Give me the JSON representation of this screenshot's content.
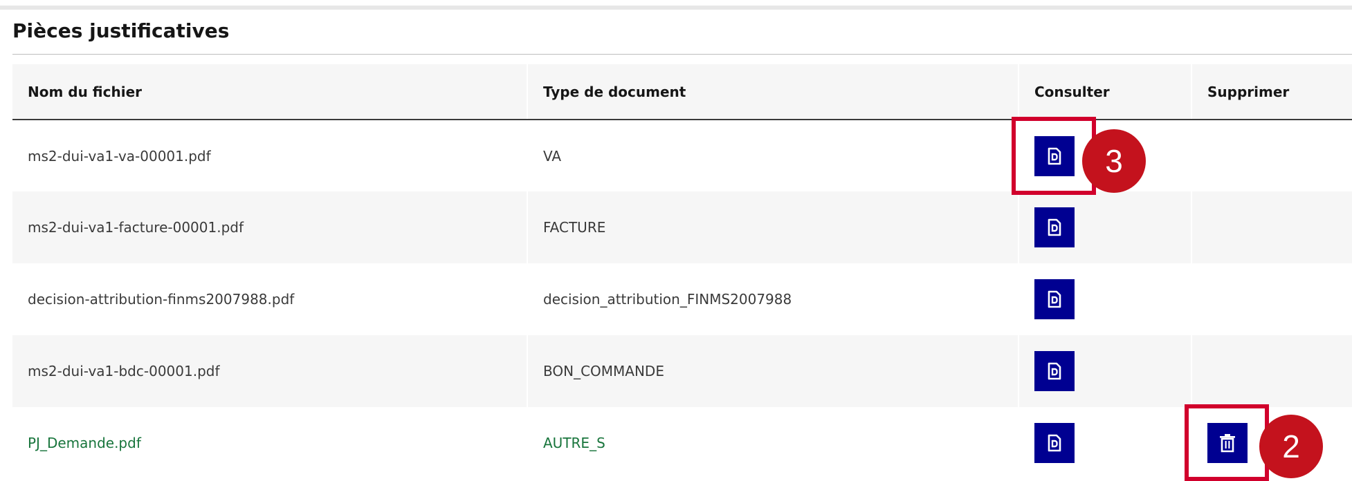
{
  "section": {
    "title": "Pièces justificatives"
  },
  "table": {
    "headers": {
      "file_name": "Nom du fichier",
      "doc_type": "Type de document",
      "view": "Consulter",
      "delete": "Supprimer"
    },
    "rows": [
      {
        "file_name": "ms2-dui-va1-va-00001.pdf",
        "doc_type": "VA",
        "can_delete": false
      },
      {
        "file_name": "ms2-dui-va1-facture-00001.pdf",
        "doc_type": "FACTURE",
        "can_delete": false
      },
      {
        "file_name": "decision-attribution-finms2007988.pdf",
        "doc_type": "decision_attribution_FINMS2007988",
        "can_delete": false
      },
      {
        "file_name": "ms2-dui-va1-bdc-00001.pdf",
        "doc_type": "BON_COMMANDE",
        "can_delete": false
      },
      {
        "file_name": "PJ_Demande.pdf",
        "doc_type": "AUTRE_S",
        "can_delete": true
      }
    ]
  },
  "icons": {
    "view": "document-icon",
    "delete": "trash-icon"
  },
  "callouts": {
    "view_marker": "3",
    "delete_marker": "2"
  },
  "colors": {
    "button_bg": "#000091",
    "highlight_text": "#18753c",
    "callout_red": "#d1002c"
  }
}
